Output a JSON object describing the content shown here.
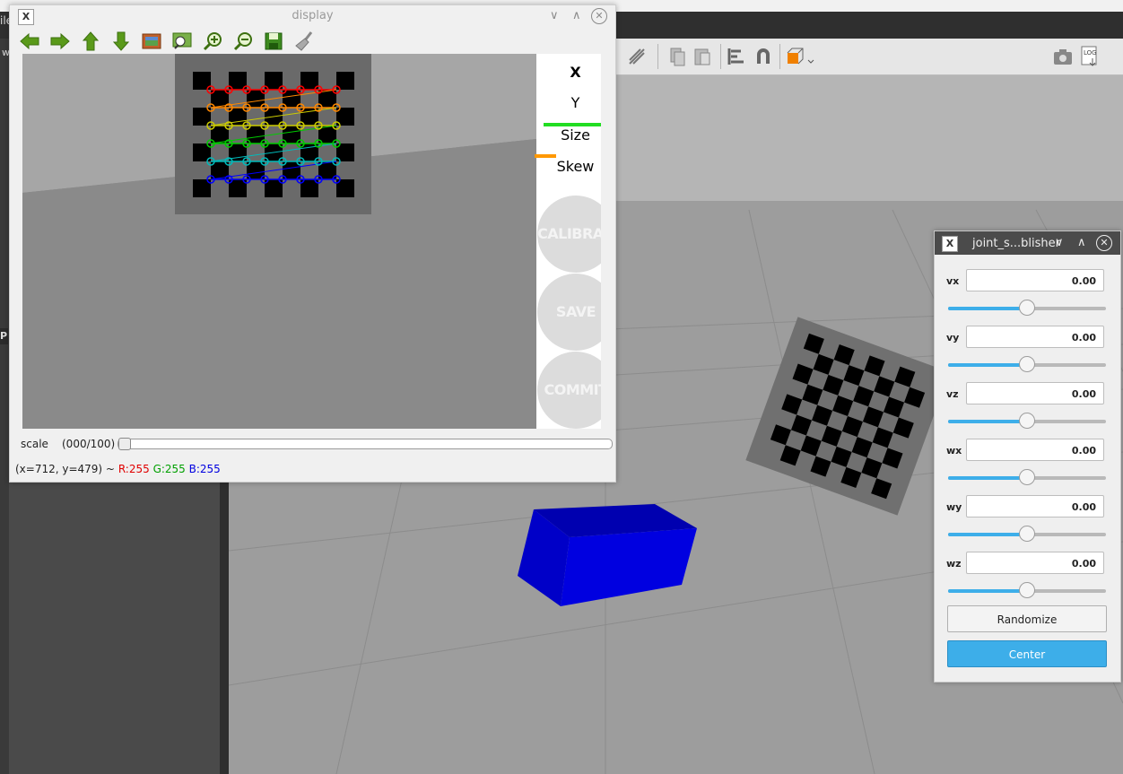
{
  "background_app": {
    "left_tag": "ile",
    "left_tag2": "w",
    "left_panel_label": "P"
  },
  "display_window": {
    "title": "display",
    "toolbar_icons": [
      "arrow-left-icon",
      "arrow-right-icon",
      "arrow-up-icon",
      "arrow-down-icon",
      "image-icon",
      "zoom-fit-icon",
      "zoom-in-icon",
      "zoom-out-icon",
      "save-icon",
      "clear-icon"
    ],
    "sidebar": {
      "x_label": "X",
      "y_label": "Y",
      "size_label": "Size",
      "skew_label": "Skew",
      "calibrate_label": "CALIBRATE",
      "save_label": "SAVE",
      "commit_label": "COMMIT"
    },
    "scale_label": "scale",
    "scale_value": "(000/100)",
    "status": {
      "coords": "(x=712, y=479) ~",
      "r": "R:255",
      "g": "G:255",
      "b": "B:255"
    }
  },
  "joint_state_publisher": {
    "title": "joint_s...blisher",
    "joints": [
      {
        "name": "vx",
        "value": "0.00",
        "slider_fraction": 0.5
      },
      {
        "name": "vy",
        "value": "0.00",
        "slider_fraction": 0.5
      },
      {
        "name": "vz",
        "value": "0.00",
        "slider_fraction": 0.5
      },
      {
        "name": "wx",
        "value": "0.00",
        "slider_fraction": 0.5
      },
      {
        "name": "wy",
        "value": "0.00",
        "slider_fraction": 0.5
      },
      {
        "name": "wz",
        "value": "0.00",
        "slider_fraction": 0.5
      }
    ],
    "randomize_label": "Randomize",
    "center_label": "Center"
  },
  "colors": {
    "accent": "#3daee9",
    "box_blue": "#0000cc",
    "calibrate_disabled": "#dcdcdc"
  }
}
